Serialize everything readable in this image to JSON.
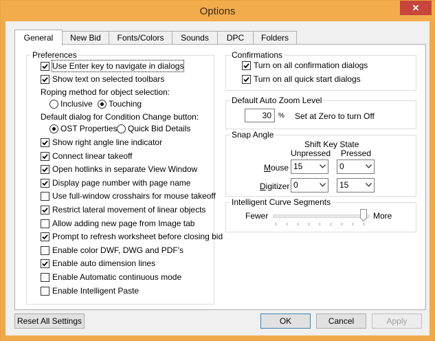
{
  "window": {
    "title": "Options",
    "close_glyph": "✕"
  },
  "tabs": [
    "General",
    "New Bid",
    "Fonts/Colors",
    "Sounds",
    "DPC",
    "Folders"
  ],
  "preferences": {
    "title": "Preferences",
    "items": [
      {
        "label": "Use Enter key to navigate in dialogs",
        "checked": true
      },
      {
        "label": "Show text on selected toolbars",
        "checked": true
      },
      {
        "label": "Show right angle line indicator",
        "checked": true
      },
      {
        "label": "Connect linear takeoff",
        "checked": true
      },
      {
        "label": "Open hotlinks in separate View Window",
        "checked": true
      },
      {
        "label": "Display page number with page name",
        "checked": true
      },
      {
        "label": "Use full-window crosshairs for mouse takeoff",
        "checked": false
      },
      {
        "label": "Restrict lateral movement of linear objects",
        "checked": true
      },
      {
        "label": "Allow adding new page from Image tab",
        "checked": false
      },
      {
        "label": "Prompt to refresh worksheet before closing bid",
        "checked": true
      },
      {
        "label": "Enable color DWF, DWG and PDF's",
        "checked": false
      },
      {
        "label": "Enable auto dimension lines",
        "checked": true
      },
      {
        "label": "Enable Automatic continuous mode",
        "checked": false
      },
      {
        "label": "Enable Intelligent Paste",
        "checked": false
      }
    ],
    "roping": {
      "label": "Roping method for object selection:",
      "options": [
        "Inclusive",
        "Touching"
      ],
      "selected": "Touching"
    },
    "default_dialog": {
      "label": "Default dialog for Condition Change button:",
      "options": [
        "OST Properties",
        "Quick Bid Details"
      ],
      "selected": "OST Properties"
    }
  },
  "confirmations": {
    "title": "Confirmations",
    "items": [
      {
        "label": "Turn on all confirmation dialogs",
        "checked": true
      },
      {
        "label": "Turn on all quick start dialogs",
        "checked": true
      }
    ]
  },
  "zoom": {
    "title": "Default Auto Zoom Level",
    "value": "30",
    "unit": "%",
    "hint": "Set at Zero to turn Off"
  },
  "snap": {
    "title": "Snap Angle",
    "shift_header": "Shift Key State",
    "col_unpressed": "Unpressed",
    "col_pressed": "Pressed",
    "rows": [
      {
        "label": "Mouse",
        "unpressed": "15",
        "pressed": "0"
      },
      {
        "label": "Digitizer",
        "unpressed": "0",
        "pressed": "15"
      }
    ]
  },
  "curve": {
    "title": "Intelligent Curve Segments",
    "min_label": "Fewer",
    "max_label": "More",
    "level": 1.0
  },
  "buttons": {
    "reset": "Reset All Settings",
    "ok": "OK",
    "cancel": "Cancel",
    "apply": "Apply"
  }
}
